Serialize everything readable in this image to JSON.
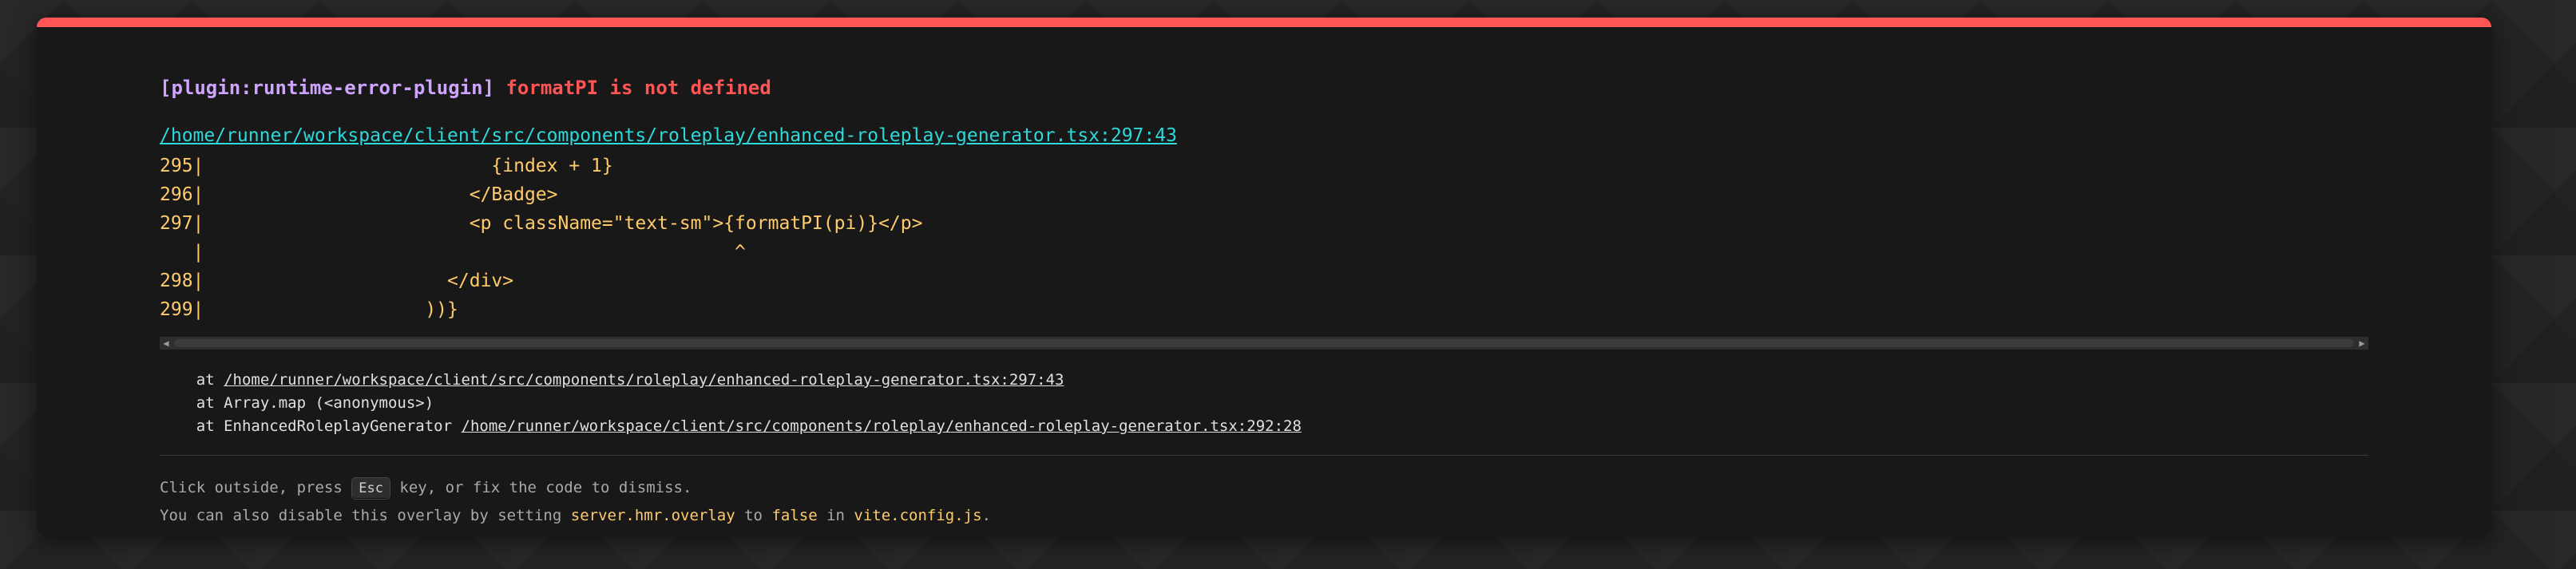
{
  "error": {
    "plugin_tag": "[plugin:runtime-error-plugin]",
    "message": "formatPI is not defined",
    "file_link": "/home/runner/workspace/client/src/components/roleplay/enhanced-roleplay-generator.tsx:297:43"
  },
  "code_frame": [
    "295|                          {index + 1}",
    "296|                        </Badge>",
    "297|                        <p className=\"text-sm\">{formatPI(pi)}</p>",
    "   |                                                ^",
    "298|                      </div>",
    "299|                    ))}"
  ],
  "stack": {
    "frame1_prefix": "at ",
    "frame1_file": "/home/runner/workspace/client/src/components/roleplay/enhanced-roleplay-generator.tsx:297:43",
    "frame2": "at Array.map (<anonymous>)",
    "frame3_prefix": "at EnhancedRoleplayGenerator ",
    "frame3_file": "/home/runner/workspace/client/src/components/roleplay/enhanced-roleplay-generator.tsx:292:28"
  },
  "tip": {
    "line1_before": "Click outside, press ",
    "line1_key": "Esc",
    "line1_after": " key, or fix the code to dismiss.",
    "line2_a": "You can also disable this overlay by setting ",
    "line2_setting": "server.hmr.overlay",
    "line2_b": " to ",
    "line2_value": "false",
    "line2_c": " in ",
    "line2_file": "vite.config.js",
    "line2_d": "."
  },
  "scrollbar": {
    "left_arrow": "◀",
    "right_arrow": "▶"
  },
  "colors": {
    "accent_red": "#ff5555",
    "plugin_purple": "#cfa4ff",
    "link_cyan": "#2dd9da",
    "code_yellow": "#ffcb6b",
    "overlay_bg": "#181818"
  }
}
